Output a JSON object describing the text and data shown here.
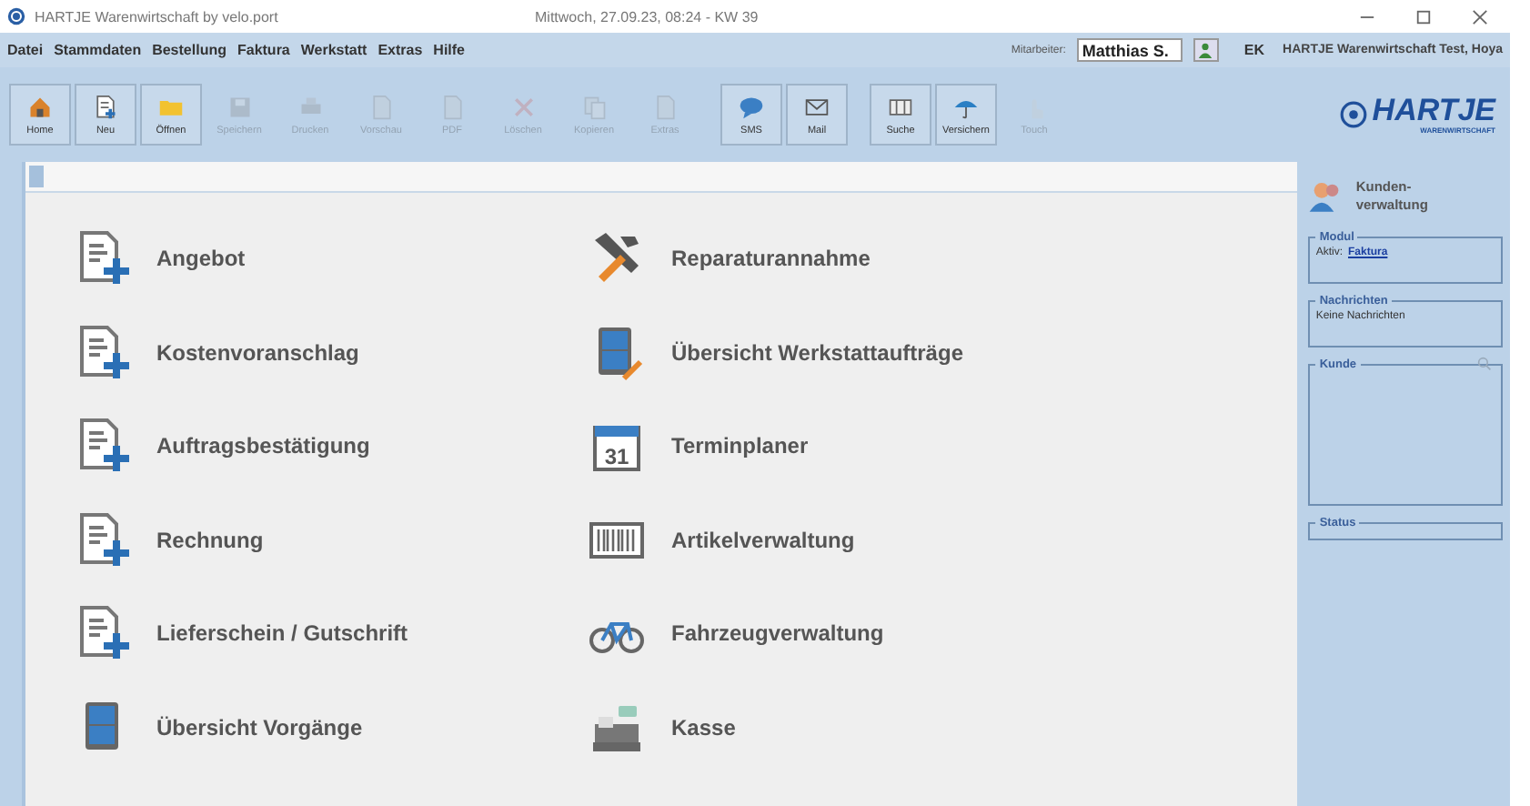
{
  "window": {
    "title": "HARTJE Warenwirtschaft by velo.port",
    "datetime": "Mittwoch, 27.09.23, 08:24  -  KW 39"
  },
  "menu": [
    "Datei",
    "Stammdaten",
    "Bestellung",
    "Faktura",
    "Werkstatt",
    "Extras",
    "Hilfe"
  ],
  "user_bar": {
    "label": "Mitarbeiter:",
    "value": "Matthias S.",
    "code": "EK",
    "company": "HARTJE Warenwirtschaft Test, Hoya"
  },
  "toolbar": [
    [
      {
        "label": "Home",
        "kind": "house",
        "disabled": false
      },
      {
        "label": "Neu",
        "kind": "doc-plus",
        "disabled": false
      },
      {
        "label": "Öffnen",
        "kind": "folder",
        "disabled": false
      },
      {
        "label": "Speichern",
        "kind": "floppy",
        "disabled": true
      },
      {
        "label": "Drucken",
        "kind": "printer",
        "disabled": true
      },
      {
        "label": "Vorschau",
        "kind": "doc",
        "disabled": true
      },
      {
        "label": "PDF",
        "kind": "doc",
        "disabled": true
      },
      {
        "label": "Löschen",
        "kind": "cross",
        "disabled": true
      },
      {
        "label": "Kopieren",
        "kind": "copy",
        "disabled": true
      },
      {
        "label": "Extras",
        "kind": "doc",
        "disabled": true
      }
    ],
    [
      {
        "label": "SMS",
        "kind": "chat",
        "disabled": false
      },
      {
        "label": "Mail",
        "kind": "envelope",
        "disabled": false
      }
    ],
    [
      {
        "label": "Suche",
        "kind": "columns",
        "disabled": false
      },
      {
        "label": "Versichern",
        "kind": "umbrella",
        "disabled": false
      },
      {
        "label": "Touch",
        "kind": "hand",
        "disabled": true
      }
    ]
  ],
  "logo": {
    "name": "HARTJE",
    "tagline": "WARENWIRTSCHAFT"
  },
  "tiles": [
    [
      {
        "label": "Angebot",
        "kind": "doc-plus"
      },
      {
        "label": "Kostenvoranschlag",
        "kind": "doc-plus"
      },
      {
        "label": "Auftragsbestätigung",
        "kind": "doc-plus"
      },
      {
        "label": "Rechnung",
        "kind": "doc-plus"
      },
      {
        "label": "Lieferschein / Gutschrift",
        "kind": "doc-plus"
      },
      {
        "label": "Übersicht Vorgänge",
        "kind": "cabinet"
      }
    ],
    [
      {
        "label": "Reparaturannahme",
        "kind": "tools"
      },
      {
        "label": "Übersicht Werkstattaufträge",
        "kind": "cabinet-wrench"
      },
      {
        "label": "Terminplaner",
        "kind": "calendar",
        "day": "31"
      },
      {
        "label": "Artikelverwaltung",
        "kind": "barcode"
      },
      {
        "label": "Fahrzeugverwaltung",
        "kind": "bike"
      },
      {
        "label": "Kasse",
        "kind": "register"
      }
    ]
  ],
  "side_panel": {
    "title": "Kunden-\nverwaltung",
    "groups": [
      {
        "title": "Modul",
        "kind": "module",
        "prefix": "Aktiv:",
        "link": "Faktura"
      },
      {
        "title": "Nachrichten",
        "kind": "text",
        "text": "Keine Nachrichten"
      },
      {
        "title": "Kunde",
        "kind": "customer"
      },
      {
        "title": "Status",
        "kind": "empty"
      }
    ]
  }
}
